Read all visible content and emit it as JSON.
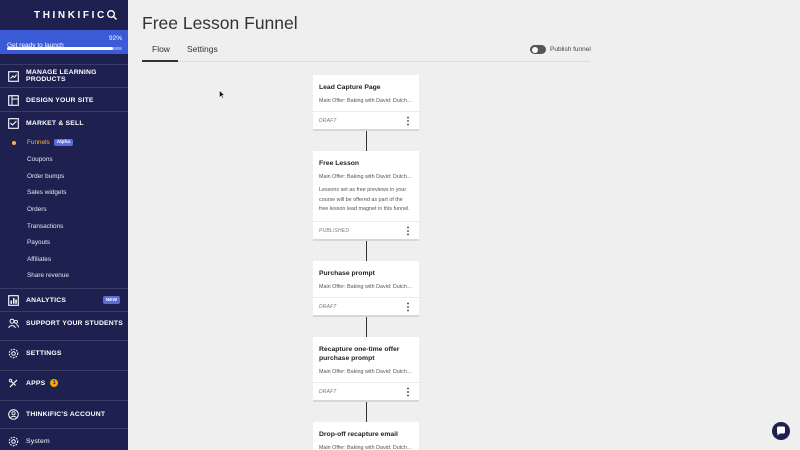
{
  "sidebar": {
    "brand": "THINKIFIC",
    "launch": {
      "label": "Get ready to launch",
      "percent_text": "92%",
      "progress": 0.92
    },
    "main_items": [
      {
        "label": "MANAGE LEARNING PRODUCTS",
        "icon": "products-icon"
      },
      {
        "label": "DESIGN YOUR SITE",
        "icon": "design-icon"
      },
      {
        "label": "MARKET & SELL",
        "icon": "market-icon"
      },
      {
        "label": "ANALYTICS",
        "icon": "analytics-icon",
        "badge": "NEW"
      },
      {
        "label": "SUPPORT YOUR STUDENTS",
        "icon": "support-icon"
      },
      {
        "label": "SETTINGS",
        "icon": "gear-icon"
      },
      {
        "label": "APPS",
        "icon": "apps-icon",
        "badge": "1"
      },
      {
        "label": "THINKIFIC'S ACCOUNT",
        "icon": "account-icon"
      }
    ],
    "market_sub": [
      {
        "label": "Funnels",
        "badge": "Alpha",
        "active": true
      },
      {
        "label": "Coupons"
      },
      {
        "label": "Order bumps"
      },
      {
        "label": "Sales widgets"
      },
      {
        "label": "Orders"
      },
      {
        "label": "Transactions"
      },
      {
        "label": "Payouts"
      },
      {
        "label": "Affiliates"
      },
      {
        "label": "Share revenue"
      }
    ],
    "system_label": "System"
  },
  "page": {
    "title": "Free Lesson Funnel",
    "tabs": [
      {
        "label": "Flow",
        "active": true
      },
      {
        "label": "Settings"
      }
    ],
    "publish_toggle_label": "Publish funnel",
    "publish_on": false
  },
  "funnel_steps": [
    {
      "title": "Lead Capture Page",
      "offer": "Main Offer: Baking with David: Dutch Oven",
      "status": "DRAFT"
    },
    {
      "title": "Free Lesson",
      "offer": "Main Offer: Baking with David: Dutch Oven",
      "description": "Lessons set as free previews in your course will be offered as part of the free lesson lead magnet in this funnel.",
      "status": "PUBLISHED"
    },
    {
      "title": "Purchase prompt",
      "offer": "Main Offer: Baking with David: Dutch Oven",
      "status": "DRAFT"
    },
    {
      "title": "Recapture one-time offer purchase prompt",
      "offer": "Main Offer: Baking with David: Dutch Oven",
      "status": "DRAFT"
    },
    {
      "title": "Drop-off recapture email",
      "offer": "Main Offer: Baking with David: Dutch Oven"
    }
  ],
  "colors": {
    "sidebar_bg": "#1e2150",
    "launch_bg": "#3b5bd6",
    "accent": "#f5b53a",
    "page_bg": "#efefef"
  }
}
